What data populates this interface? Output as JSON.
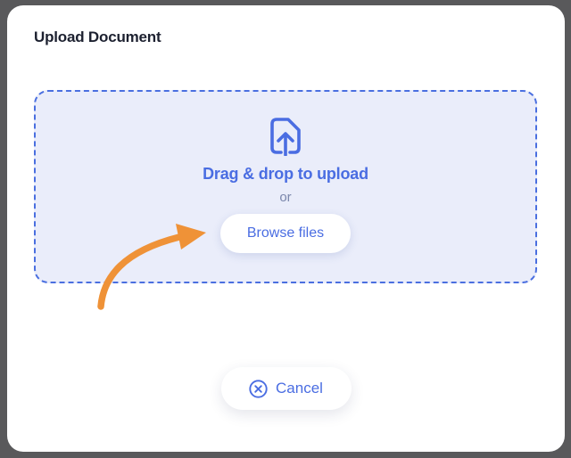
{
  "dialog": {
    "title": "Upload Document"
  },
  "dropzone": {
    "heading": "Drag & drop to upload",
    "separator": "or",
    "browse_label": "Browse files",
    "icon": "file-upload-icon"
  },
  "footer": {
    "cancel_label": "Cancel",
    "cancel_icon": "x-circle-icon"
  },
  "annotations": {
    "arrow": "curved-arrow-pointing-to-browse-files-button"
  },
  "colors": {
    "accent_blue": "#4a6de2",
    "dashed_border_blue": "#4a6fe0",
    "dropzone_background": "#eaedfa",
    "arrow_orange": "#ef9237",
    "title_text": "#1d2130",
    "separator_text": "#7b87ac",
    "modal_background": "#ffffff",
    "backdrop": "#59595b"
  }
}
